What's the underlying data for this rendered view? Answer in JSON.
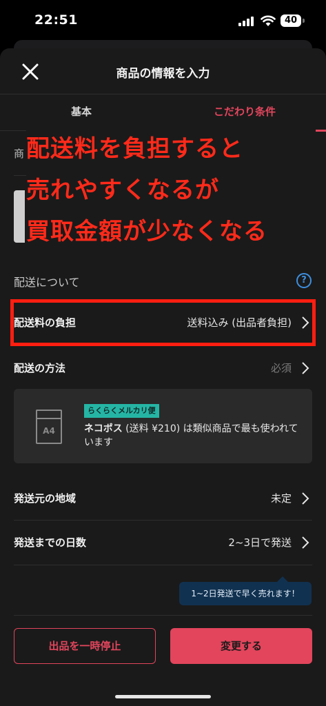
{
  "status_bar": {
    "time": "22:51",
    "battery": "40"
  },
  "header": {
    "title": "商品の情報を入力",
    "close_icon": "close-icon"
  },
  "tabs": [
    {
      "label": "基本",
      "active": false
    },
    {
      "label": "こだわり条件",
      "active": true
    }
  ],
  "hidden_row": {
    "label_fragment": "商"
  },
  "annotation": {
    "lines": [
      "配送料を負担すると",
      "売れやすくなるが",
      "買取金額が少なくなる"
    ],
    "color": "#ff2a1a"
  },
  "shipping_section": {
    "title": "配送について",
    "help_icon": "help-icon",
    "rows": {
      "burden": {
        "label": "配送料の負担",
        "value": "送料込み (出品者負担)"
      },
      "method": {
        "label": "配送の方法",
        "value": "必須"
      },
      "region": {
        "label": "発送元の地域",
        "value": "未定"
      },
      "days": {
        "label": "発送までの日数",
        "value": "2~3日で発送"
      }
    },
    "card": {
      "icon_label": "A4",
      "badge": "らくらくメルカリ便",
      "desc_bold": "ネコポス",
      "desc_rest": " (送料 ¥210) は類似商品で最も使われています"
    },
    "tooltip": "1~2日発送で早く売れます！"
  },
  "footer": {
    "pause_label": "出品を一時停止",
    "change_label": "変更する"
  },
  "colors": {
    "accent": "#e2455c",
    "badge": "#25b5a5",
    "highlight": "#ff1e10"
  }
}
